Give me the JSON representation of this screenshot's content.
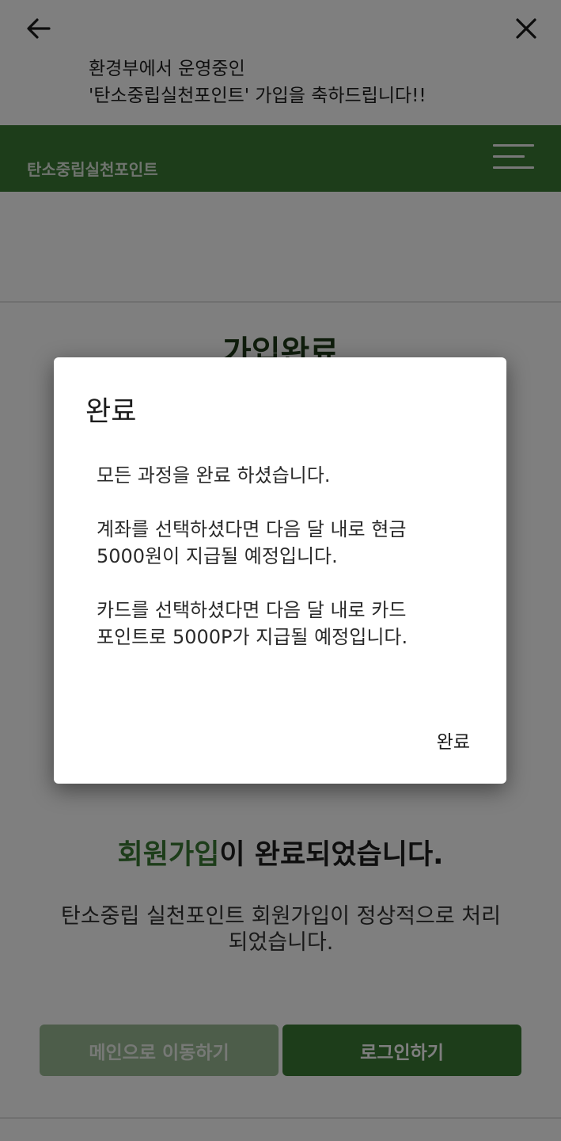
{
  "topbar": {
    "back_icon": "arrow-left-icon",
    "close_icon": "close-icon",
    "message_line1": "환경부에서 운영중인",
    "message_line2": "'탄소중립실천포인트' 가입을 축하드립니다!!"
  },
  "header": {
    "site_title": "탄소중립실천포인트",
    "menu_icon": "hamburger-menu-icon",
    "brand_color": "#3b7a35"
  },
  "page": {
    "title": "가입완료",
    "heading_accent": "회원가입",
    "heading_rest": "이 완료되었습니다.",
    "description_line1": "탄소중립 실천포인트 회원가입이 정상적으로 처리",
    "description_line2": "되었습니다.",
    "main_button_label": "메인으로 이동하기",
    "login_button_label": "로그인하기"
  },
  "dialog": {
    "title": "완료",
    "body_p1": "모든 과정을 완료 하셨습니다.",
    "body_p2_line1": " 계좌를 선택하셨다면 다음 달 내로 현금",
    "body_p2_line2": "5000원이 지급될 예정입니다.",
    "body_p3_line1": " 카드를 선택하셨다면 다음 달 내로 카드",
    "body_p3_line2": "포인트로 5000P가 지급될 예정입니다.",
    "confirm_label": "완료"
  }
}
